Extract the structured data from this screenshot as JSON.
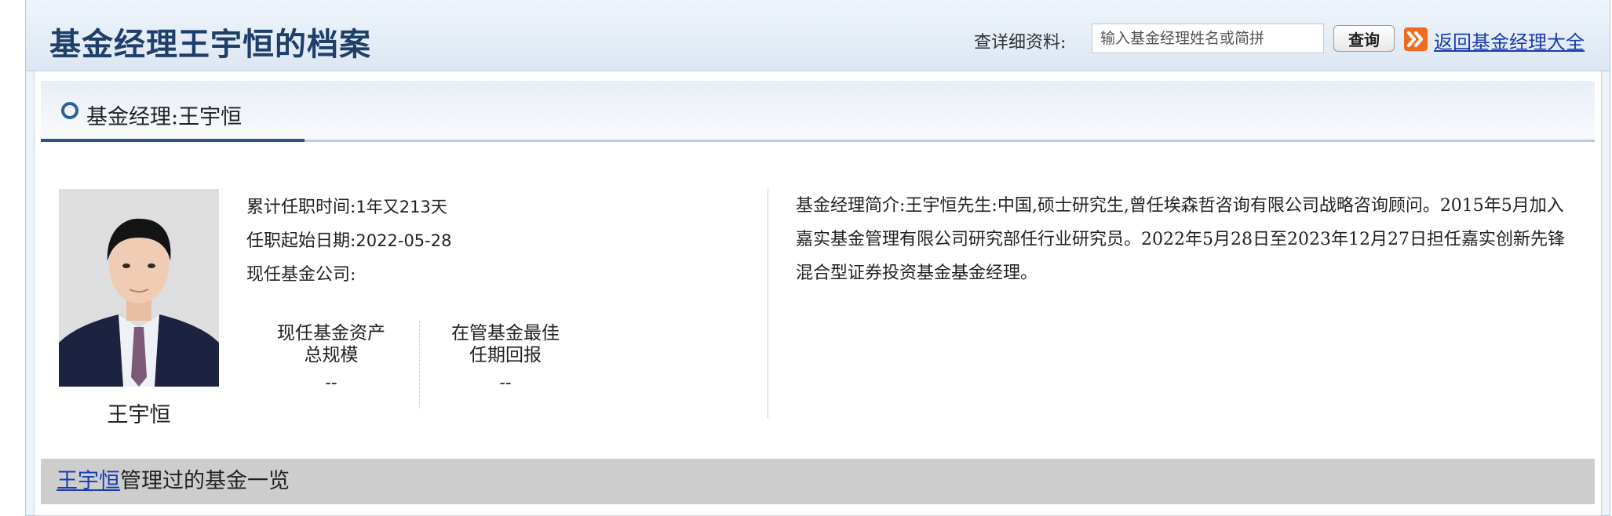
{
  "header": {
    "title": "基金经理王宇恒的档案",
    "search_label": "查详细资料:",
    "search_placeholder": "输入基金经理姓名或简拼",
    "query_button": "查询",
    "back_link": "返回基金经理大全",
    "arrow_icon_color": "#f26b1d"
  },
  "section": {
    "title": "基金经理:王宇恒"
  },
  "profile": {
    "name": "王宇恒",
    "tenure_label": "累计任职时间:",
    "tenure_value": "1年又213天",
    "start_label": "任职起始日期:",
    "start_value": "2022-05-28",
    "company_label": "现任基金公司:",
    "company_value": "",
    "stats": [
      {
        "label_line1": "现任基金资产",
        "label_line2": "总规模",
        "value": "--"
      },
      {
        "label_line1": "在管基金最佳",
        "label_line2": "任期回报",
        "value": "--"
      }
    ],
    "intro": "基金经理简介:王宇恒先生:中国,硕士研究生,曾任埃森哲咨询有限公司战略咨询顾问。2015年5月加入嘉实基金管理有限公司研究部任行业研究员。2022年5月28日至2023年12月27日担任嘉实创新先锋混合型证券投资基金基金经理。"
  },
  "funds_section": {
    "name_link": "王宇恒",
    "suffix": "管理过的基金一览"
  },
  "colors": {
    "title": "#1f3f6b",
    "link": "#1a3bb0",
    "accent": "#2a558c"
  }
}
